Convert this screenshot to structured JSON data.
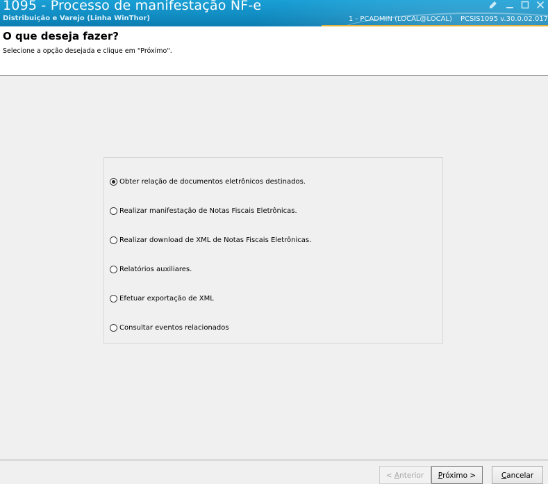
{
  "window": {
    "title": "1095 - Processo de manifestação NF-e",
    "subtitle": "Distribuição e Varejo (Linha WinThor)",
    "user_info": "1 - PCADMIN (LOCAL@LOCAL)",
    "version_info": "PCSIS1095  v.30.0.02.017",
    "accent_color": "#e2b23a",
    "controls": [
      "edit-icon",
      "minimize-icon",
      "maximize-icon",
      "close-icon"
    ]
  },
  "header": {
    "title": "O que deseja fazer?",
    "instruction": "Selecione a opção desejada e clique em \"Próximo\"."
  },
  "options": [
    {
      "label": "Obter relação de documentos eletrônicos destinados.",
      "selected": true
    },
    {
      "label": "Realizar manifestação de Notas Fiscais Eletrônicas.",
      "selected": false
    },
    {
      "label": "Realizar download de XML de Notas Fiscais Eletrônicas.",
      "selected": false
    },
    {
      "label": "Relatórios auxiliares.",
      "selected": false
    },
    {
      "label": "Efetuar exportação de XML",
      "selected": false
    },
    {
      "label": "Consultar eventos relacionados",
      "selected": false
    }
  ],
  "footer": {
    "back_prefix": "< ",
    "back_mnemonic": "A",
    "back_rest": "nterior",
    "back_enabled": false,
    "next_mnemonic": "P",
    "next_rest": "róximo >",
    "cancel_mnemonic": "C",
    "cancel_rest": "ancelar"
  }
}
